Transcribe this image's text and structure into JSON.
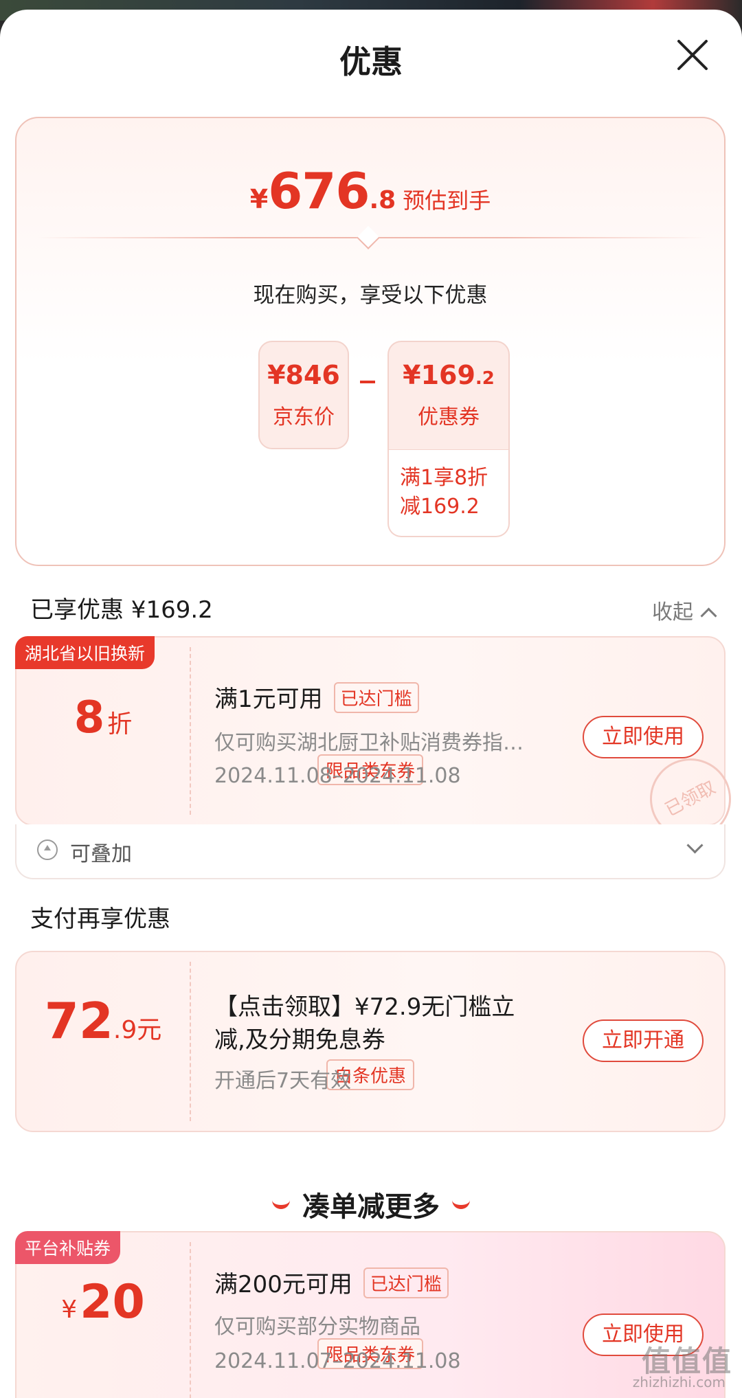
{
  "header": {
    "title": "优惠"
  },
  "summary": {
    "currency": "¥",
    "price_int": "676",
    "price_dec": ".8",
    "price_label": "预估到手",
    "subtitle": "现在购买，享受以下优惠",
    "base_price": "¥846",
    "base_label": "京东价",
    "coupon_value_int": "¥169",
    "coupon_value_dec": ".2",
    "coupon_label": "优惠券",
    "coupon_detail_1": "满1享8折",
    "coupon_detail_2": "减169.2"
  },
  "enjoyed": {
    "title": "已享优惠 ¥169.2",
    "collapse_label": "收起"
  },
  "coupon1": {
    "tag": "湖北省以旧换新",
    "value": "8",
    "unit": "折",
    "type": "限品类东券",
    "headline": "满1元可用",
    "badge": "已达门槛",
    "desc": "仅可购买湖北厨卫补贴消费券指…",
    "dates": "2024.11.08–2024.11.08",
    "button": "立即使用",
    "stamp": "已领取",
    "stack_label": "可叠加"
  },
  "payment": {
    "title": "支付再享优惠",
    "value_int": "72",
    "value_dec": ".9元",
    "type": "白条优惠",
    "headline_1": "【点击领取】¥72.9无门槛立",
    "headline_2": "减,及分期免息券",
    "desc": "开通后7天有效",
    "button": "立即开通"
  },
  "more": {
    "title": "凑单减更多"
  },
  "coupon2": {
    "tag": "平台补贴券",
    "currency": "¥",
    "value": "20",
    "type": "限品类东券",
    "headline": "满200元可用",
    "badge": "已达门槛",
    "desc": "仅可购买部分实物商品",
    "dates": "2024.11.07–2024.11.08",
    "button": "立即使用"
  },
  "watermark": {
    "text": "值值值",
    "url": "zhizhizhi.com"
  },
  "colors": {
    "accent": "#e33524",
    "tag": "#e8392b"
  }
}
